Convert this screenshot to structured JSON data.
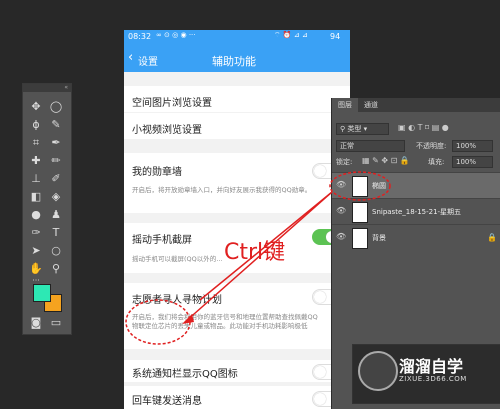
{
  "phone": {
    "status": {
      "time": "08:32",
      "battery": "94"
    },
    "nav": {
      "back_label": "设置",
      "title": "辅助功能"
    },
    "rows": [
      {
        "title": "空间图片浏览设置"
      },
      {
        "title": "小视频浏览设置"
      },
      {
        "title": "我的勋章墙",
        "desc": "开启后，将开放勋章墙入口，并向好友展示我获得的QQ勋章。"
      },
      {
        "title": "摇动手机截屏",
        "desc": "摇动手机可以截屏(QQ以外的…"
      },
      {
        "title": "志愿者寻人寻物计划",
        "desc": "开启后，我们将会利用你的蓝牙信号和地理位置帮助查找佩戴QQ物联定位芯片的丢失儿童或物品。此功能对手机功耗影响极低"
      },
      {
        "title": "系统通知栏显示QQ图标"
      },
      {
        "title": "回车键发送消息"
      }
    ]
  },
  "layers_panel": {
    "tabs": [
      "图层",
      "通道"
    ],
    "kind_label": "类型",
    "blend_mode": "正常",
    "opacity_label": "不透明度:",
    "opacity_value": "100%",
    "lock_label": "锁定:",
    "fill_label": "填充:",
    "fill_value": "100%",
    "layers": [
      {
        "name": "椭圆",
        "selected": true
      },
      {
        "name": "Snipaste_18-15-21-星期五"
      },
      {
        "name": "背景"
      }
    ]
  },
  "annotation": {
    "label": "Ctrl键"
  },
  "toolbar": {
    "fg_color": "#2de8b4",
    "bg_color": "#f5a31f"
  },
  "watermark": {
    "title": "溜溜自学",
    "url": "ZIXUE.3D66.COM"
  }
}
